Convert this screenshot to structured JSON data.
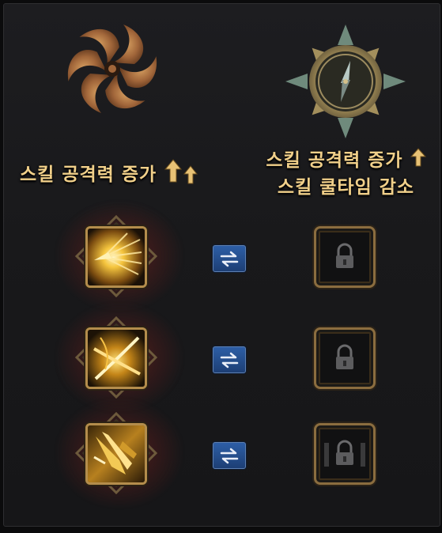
{
  "left_column": {
    "emblem": "swirl-emblem-icon",
    "title": "스킬 공격력 증가",
    "arrows": [
      "arrow-up-icon",
      "arrow-up-icon"
    ]
  },
  "right_column": {
    "emblem": "compass-emblem-icon",
    "title_line1": "스킬 공격력 증가",
    "title_line2": "스킬 쿨타임 감소",
    "arrows": [
      "arrow-up-icon"
    ]
  },
  "rows": [
    {
      "skill_icon": "light-burst-skill-icon",
      "swap": "swap-arrows-icon",
      "slot": "lock-icon",
      "slot_state": "locked"
    },
    {
      "skill_icon": "cross-slash-skill-icon",
      "swap": "swap-arrows-icon",
      "slot": "lock-icon",
      "slot_state": "locked"
    },
    {
      "skill_icon": "golden-blade-skill-icon",
      "swap": "swap-arrows-icon",
      "slot": "lock-icon",
      "slot_state": "locked"
    }
  ],
  "colors": {
    "title_gold": "#f1d08a",
    "frame_gold": "#b48d4c",
    "swap_blue": "#2d5ea6",
    "red_glow": "#962823"
  }
}
